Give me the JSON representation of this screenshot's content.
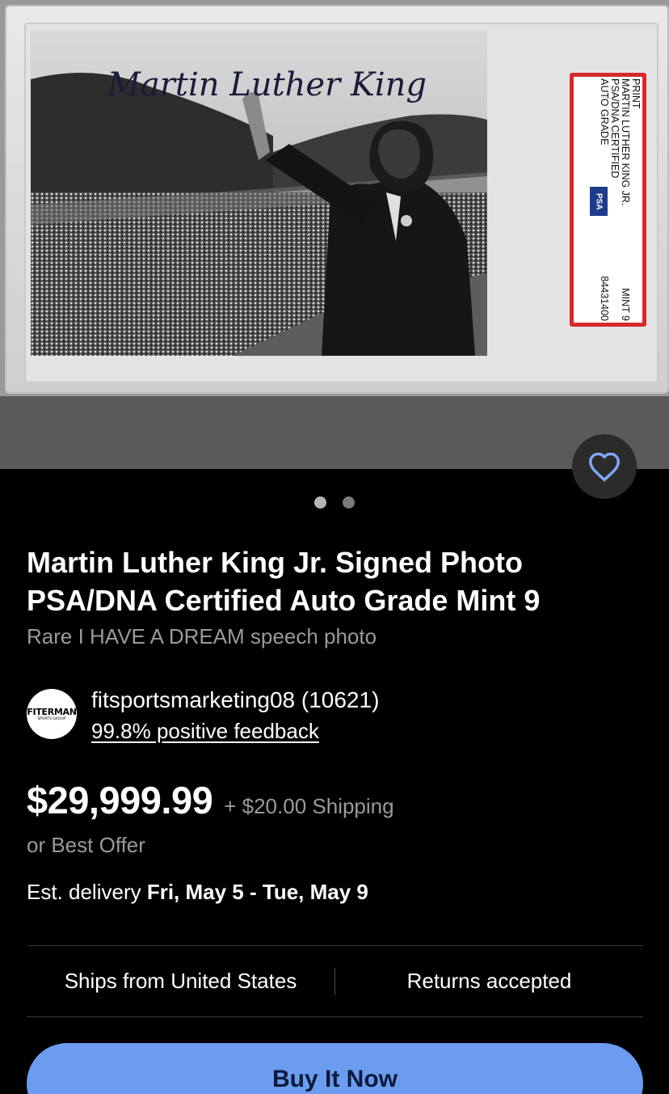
{
  "hero": {
    "photo_signature": "Martin Luther King",
    "label": {
      "line1": "PRINT",
      "line2_left": "MARTIN LUTHER KING JR.",
      "line2_right": "MINT 9",
      "line3": "PSA/DNA CERTIFIED",
      "line4_left": "AUTO GRADE",
      "line4_right": "84431400",
      "logo": "PSA"
    },
    "favorite_icon": "heart-outline-icon",
    "pager": {
      "count": 2,
      "active_index": 0
    }
  },
  "listing": {
    "title": "Martin Luther King Jr. Signed Photo PSA/DNA Certified Auto Grade Mint 9",
    "subtitle": "Rare I HAVE A DREAM speech photo"
  },
  "seller": {
    "logo_text_main": "FITERMAN",
    "logo_text_sub": "SPORTS GROUP",
    "name": "fitsportsmarketing08 (10621)",
    "feedback": "99.8% positive feedback"
  },
  "pricing": {
    "price": "$29,999.99",
    "shipping": "+ $20.00 Shipping",
    "best_offer": "or Best Offer",
    "delivery_prefix": "Est. delivery ",
    "delivery_dates": "Fri, May 5 - Tue, May 9"
  },
  "info": {
    "ships_from": "Ships from United States",
    "returns": "Returns accepted"
  },
  "actions": {
    "buy_now": "Buy It Now"
  },
  "colors": {
    "background": "#000000",
    "accent_button": "#6b9cf0",
    "heart": "#7fa8f5",
    "secondary_text": "#9a9a9a"
  }
}
